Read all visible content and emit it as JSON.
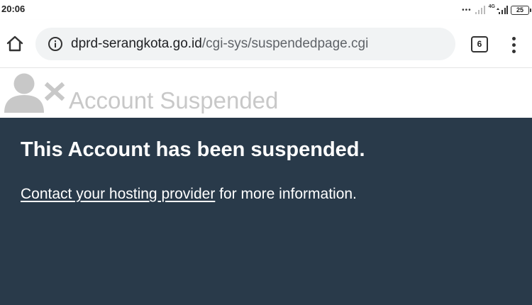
{
  "status_bar": {
    "time": "20:06",
    "network_label": "4G",
    "battery": "25"
  },
  "browser": {
    "url_domain": "dprd-serangkota.go.id",
    "url_path": "/cgi-sys/suspendedpage.cgi",
    "tab_count": "6"
  },
  "page": {
    "heading": "Account Suspended",
    "title": "This Account has been suspended.",
    "contact_link": "Contact your hosting provider",
    "info_suffix": " for more information."
  },
  "colors": {
    "content_background": "#293a4a",
    "heading_gray": "#c8c8c8",
    "url_bar_background": "#f1f3f4"
  },
  "icons": {
    "home": "home-icon",
    "info": "info-icon",
    "menu": "more-vert-icon",
    "account": "user-x-icon"
  }
}
